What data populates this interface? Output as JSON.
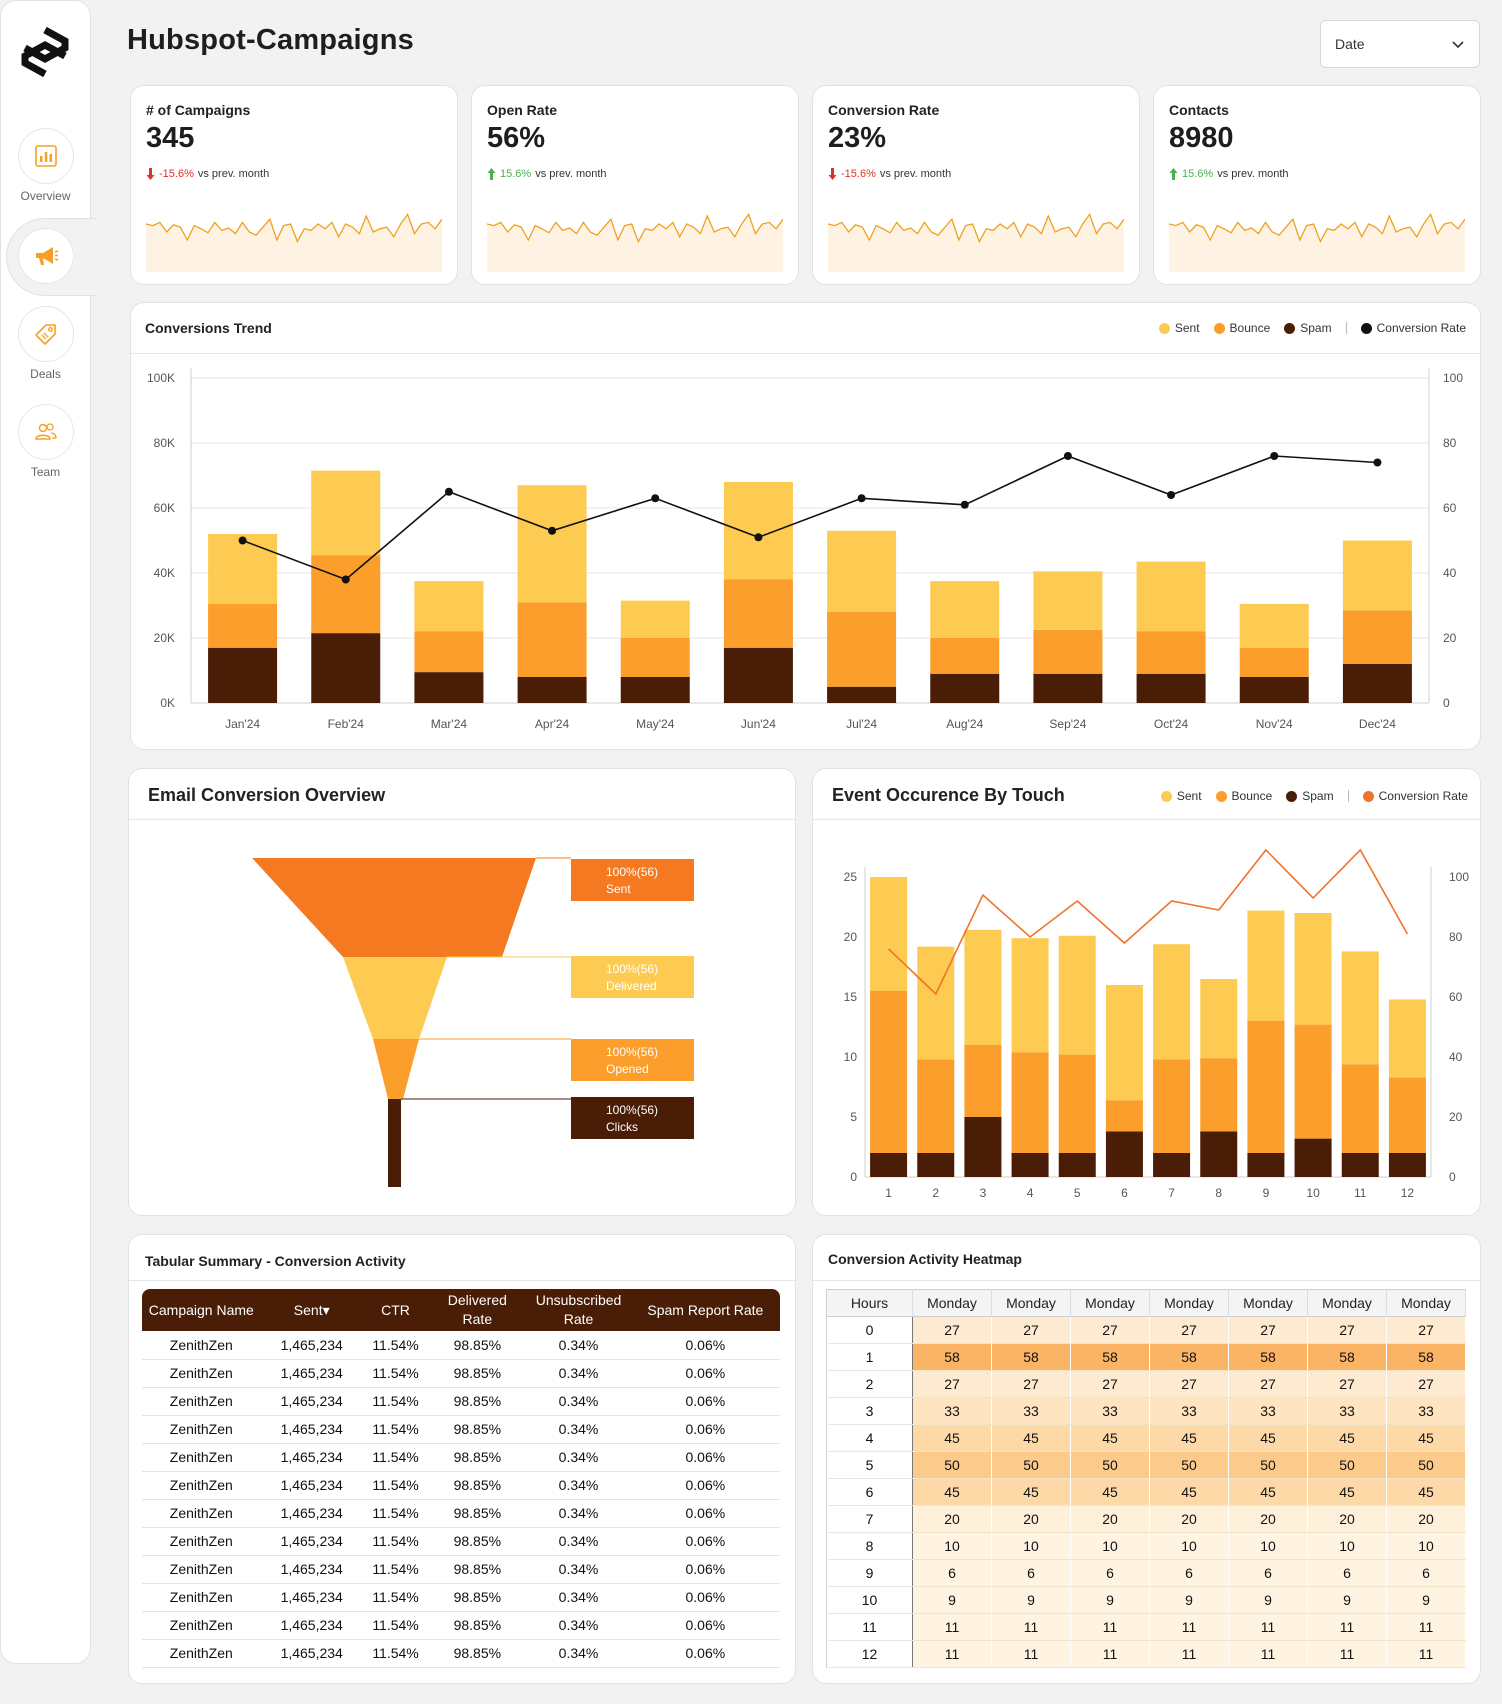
{
  "app": {
    "title": "Hubspot-Campaigns"
  },
  "date_filter": {
    "label": "Date"
  },
  "sidebar": {
    "items": [
      {
        "label": "Overview",
        "icon": "bar-chart-icon"
      },
      {
        "label": "",
        "icon": "megaphone-icon"
      },
      {
        "label": "Deals",
        "icon": "tag-icon"
      },
      {
        "label": "Team",
        "icon": "users-icon"
      }
    ]
  },
  "colors": {
    "sent": "#fdcb52",
    "bounce": "#fb9e2c",
    "spam": "#4a1d06",
    "line": "#111111",
    "event_line": "#f0732a",
    "funnel_sent": "#f47920",
    "funnel_delivered": "#fdcb52",
    "funnel_opened": "#fb9e2c",
    "funnel_clicks": "#4a1d06"
  },
  "kpis": [
    {
      "label": "# of Campaigns",
      "value": "345",
      "delta": "-15.6%",
      "delta_dir": "down",
      "delta_suffix": "vs prev. month",
      "spark": [
        60,
        58,
        62,
        50,
        59,
        56,
        40,
        58,
        54,
        49,
        62,
        52,
        55,
        48,
        62,
        50,
        46,
        56,
        66,
        40,
        58,
        60,
        38,
        54,
        52,
        60,
        54,
        62,
        44,
        60,
        56,
        48,
        70,
        50,
        54,
        56,
        44,
        60,
        72,
        48,
        60,
        62,
        54,
        66
      ]
    },
    {
      "label": "Open Rate",
      "value": "56%",
      "delta": "15.6%",
      "delta_dir": "up",
      "delta_suffix": "vs prev. month",
      "spark": [
        60,
        58,
        62,
        50,
        59,
        56,
        40,
        58,
        54,
        49,
        62,
        52,
        55,
        48,
        62,
        50,
        46,
        56,
        66,
        40,
        58,
        60,
        38,
        54,
        52,
        60,
        54,
        62,
        44,
        60,
        56,
        48,
        70,
        50,
        54,
        56,
        44,
        60,
        72,
        48,
        60,
        62,
        54,
        66
      ]
    },
    {
      "label": "Conversion Rate",
      "value": "23%",
      "delta": "-15.6%",
      "delta_dir": "down",
      "delta_suffix": "vs prev. month",
      "spark": [
        60,
        58,
        62,
        50,
        59,
        56,
        40,
        58,
        54,
        49,
        62,
        52,
        55,
        48,
        62,
        50,
        46,
        56,
        66,
        40,
        58,
        60,
        38,
        54,
        52,
        60,
        54,
        62,
        44,
        60,
        56,
        48,
        70,
        50,
        54,
        56,
        44,
        60,
        72,
        48,
        60,
        62,
        54,
        66
      ]
    },
    {
      "label": "Contacts",
      "value": "8980",
      "delta": "15.6%",
      "delta_dir": "up",
      "delta_suffix": "vs prev. month",
      "spark": [
        60,
        58,
        62,
        50,
        59,
        56,
        40,
        58,
        54,
        49,
        62,
        52,
        55,
        48,
        62,
        50,
        46,
        56,
        66,
        40,
        58,
        60,
        38,
        54,
        52,
        60,
        54,
        62,
        44,
        60,
        56,
        48,
        70,
        50,
        54,
        56,
        44,
        60,
        72,
        48,
        60,
        62,
        54,
        66
      ]
    }
  ],
  "chart_data": [
    {
      "type": "bar",
      "title": "Conversions Trend",
      "stacked": true,
      "categories": [
        "Jan'24",
        "Feb'24",
        "Mar'24",
        "Apr'24",
        "May'24",
        "Jun'24",
        "Jul'24",
        "Aug'24",
        "Sep'24",
        "Oct'24",
        "Nov'24",
        "Dec'24"
      ],
      "series": [
        {
          "name": "Spam",
          "values": [
            17000,
            21500,
            9500,
            8000,
            8000,
            17000,
            5000,
            9000,
            9000,
            9000,
            8000,
            12000
          ]
        },
        {
          "name": "Bounce",
          "values": [
            13500,
            24000,
            12500,
            23000,
            12000,
            21000,
            23000,
            11000,
            13500,
            13000,
            9000,
            16500
          ]
        },
        {
          "name": "Sent",
          "values": [
            21500,
            26000,
            15500,
            36000,
            11500,
            30000,
            25000,
            17500,
            18000,
            21500,
            13500,
            21500
          ]
        }
      ],
      "line": {
        "name": "Conversion Rate",
        "values": [
          50,
          38,
          65,
          53,
          63,
          51,
          63,
          61,
          76,
          64,
          76,
          74
        ]
      },
      "y_left_ticks": [
        "0K",
        "20K",
        "40K",
        "60K",
        "80K",
        "100K"
      ],
      "y_right_ticks": [
        "0",
        "20",
        "40",
        "60",
        "80",
        "100"
      ],
      "ylim": [
        0,
        100000
      ],
      "y2lim": [
        0,
        100
      ],
      "legend": [
        "Sent",
        "Bounce",
        "Spam",
        "Conversion Rate"
      ],
      "legend_position": "top-right",
      "grid": true
    },
    {
      "type": "bar",
      "title": "Event Occurence By Touch",
      "stacked": true,
      "categories": [
        "1",
        "2",
        "3",
        "4",
        "5",
        "6",
        "7",
        "8",
        "9",
        "10",
        "11",
        "12"
      ],
      "series": [
        {
          "name": "Spam",
          "values": [
            2,
            2,
            5,
            2,
            2,
            3.8,
            2,
            3.8,
            2,
            3.2,
            2,
            2
          ]
        },
        {
          "name": "Bounce",
          "values": [
            13.5,
            7.8,
            6,
            8.4,
            8.2,
            2.6,
            7.8,
            6.1,
            11,
            9.5,
            7.4,
            6.3
          ]
        },
        {
          "name": "Sent",
          "values": [
            9.5,
            9.4,
            9.6,
            9.5,
            9.9,
            9.6,
            9.6,
            6.6,
            9.2,
            9.3,
            9.4,
            6.5
          ]
        }
      ],
      "line": {
        "name": "Conversion Rate",
        "values": [
          76,
          61,
          94,
          80,
          92,
          78,
          92,
          89,
          109,
          93,
          109,
          81
        ]
      },
      "y_left_ticks": [
        "0",
        "5",
        "10",
        "15",
        "20",
        "25"
      ],
      "y_right_ticks": [
        "0",
        "20",
        "40",
        "60",
        "80",
        "100"
      ],
      "ylim": [
        0,
        25
      ],
      "y2lim": [
        0,
        100
      ],
      "legend": [
        "Sent",
        "Bounce",
        "Spam",
        "Conversion Rate"
      ],
      "legend_position": "top-right",
      "grid": false
    },
    {
      "type": "funnel",
      "title": "Email Conversion Overview",
      "stages": [
        {
          "pct": "100%(56)",
          "name": "Sent"
        },
        {
          "pct": "100%(56)",
          "name": "Delivered"
        },
        {
          "pct": "100%(56)",
          "name": "Opened"
        },
        {
          "pct": "100%(56)",
          "name": "Clicks"
        }
      ]
    }
  ],
  "summary": {
    "title": "Tabular Summary - Conversion Activity",
    "headers": [
      "Campaign Name",
      "Sent▾",
      "CTR",
      "Delivered Rate",
      "Unsubscribed Rate",
      "Spam Report Rate"
    ],
    "rows": [
      [
        "ZenithZen",
        "1,465,234",
        "11.54%",
        "98.85%",
        "0.34%",
        "0.06%"
      ],
      [
        "ZenithZen",
        "1,465,234",
        "11.54%",
        "98.85%",
        "0.34%",
        "0.06%"
      ],
      [
        "ZenithZen",
        "1,465,234",
        "11.54%",
        "98.85%",
        "0.34%",
        "0.06%"
      ],
      [
        "ZenithZen",
        "1,465,234",
        "11.54%",
        "98.85%",
        "0.34%",
        "0.06%"
      ],
      [
        "ZenithZen",
        "1,465,234",
        "11.54%",
        "98.85%",
        "0.34%",
        "0.06%"
      ],
      [
        "ZenithZen",
        "1,465,234",
        "11.54%",
        "98.85%",
        "0.34%",
        "0.06%"
      ],
      [
        "ZenithZen",
        "1,465,234",
        "11.54%",
        "98.85%",
        "0.34%",
        "0.06%"
      ],
      [
        "ZenithZen",
        "1,465,234",
        "11.54%",
        "98.85%",
        "0.34%",
        "0.06%"
      ],
      [
        "ZenithZen",
        "1,465,234",
        "11.54%",
        "98.85%",
        "0.34%",
        "0.06%"
      ],
      [
        "ZenithZen",
        "1,465,234",
        "11.54%",
        "98.85%",
        "0.34%",
        "0.06%"
      ],
      [
        "ZenithZen",
        "1,465,234",
        "11.54%",
        "98.85%",
        "0.34%",
        "0.06%"
      ],
      [
        "ZenithZen",
        "1,465,234",
        "11.54%",
        "98.85%",
        "0.34%",
        "0.06%"
      ]
    ]
  },
  "heatmap": {
    "title": "Conversion Activity Heatmap",
    "headers": [
      "Hours",
      "Monday",
      "Monday",
      "Monday",
      "Monday",
      "Monday",
      "Monday",
      "Monday"
    ],
    "rows": [
      {
        "hour": "0",
        "values": [
          27,
          27,
          27,
          27,
          27,
          27,
          27
        ]
      },
      {
        "hour": "1",
        "values": [
          58,
          58,
          58,
          58,
          58,
          58,
          58
        ]
      },
      {
        "hour": "2",
        "values": [
          27,
          27,
          27,
          27,
          27,
          27,
          27
        ]
      },
      {
        "hour": "3",
        "values": [
          33,
          33,
          33,
          33,
          33,
          33,
          33
        ]
      },
      {
        "hour": "4",
        "values": [
          45,
          45,
          45,
          45,
          45,
          45,
          45
        ]
      },
      {
        "hour": "5",
        "values": [
          50,
          50,
          50,
          50,
          50,
          50,
          50
        ]
      },
      {
        "hour": "6",
        "values": [
          45,
          45,
          45,
          45,
          45,
          45,
          45
        ]
      },
      {
        "hour": "7",
        "values": [
          20,
          20,
          20,
          20,
          20,
          20,
          20
        ]
      },
      {
        "hour": "8",
        "values": [
          10,
          10,
          10,
          10,
          10,
          10,
          10
        ]
      },
      {
        "hour": "9",
        "values": [
          6,
          6,
          6,
          6,
          6,
          6,
          6
        ]
      },
      {
        "hour": "10",
        "values": [
          9,
          9,
          9,
          9,
          9,
          9,
          9
        ]
      },
      {
        "hour": "11",
        "values": [
          11,
          11,
          11,
          11,
          11,
          11,
          11
        ]
      },
      {
        "hour": "12",
        "values": [
          11,
          11,
          11,
          11,
          11,
          11,
          11
        ]
      }
    ]
  }
}
